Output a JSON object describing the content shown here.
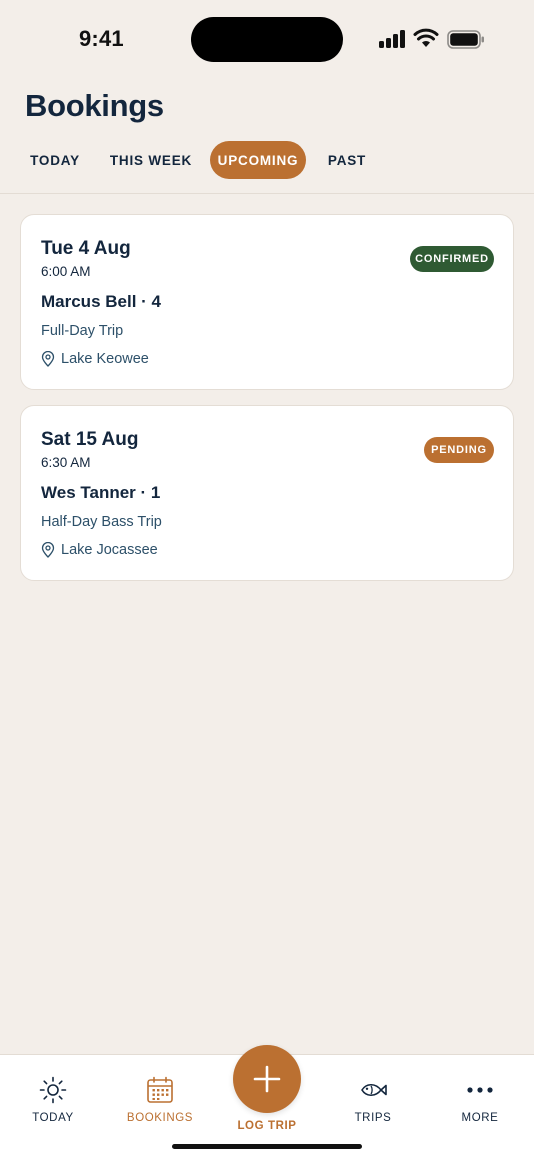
{
  "status_bar": {
    "time": "9:41"
  },
  "header": {
    "title": "Bookings"
  },
  "tabs": [
    {
      "label": "TODAY"
    },
    {
      "label": "THIS WEEK"
    },
    {
      "label": "UPCOMING"
    },
    {
      "label": "PAST"
    }
  ],
  "selected_tab": "UPCOMING",
  "bookings": [
    {
      "date": "Tue 4 Aug",
      "time": "6:00 AM",
      "client": "Marcus Bell · 4",
      "trip": "Full-Day Trip",
      "location": "Lake Keowee",
      "status": "CONFIRMED"
    },
    {
      "date": "Sat 15 Aug",
      "time": "6:30 AM",
      "client": "Wes Tanner · 1",
      "trip": "Half-Day Bass Trip",
      "location": "Lake Jocassee",
      "status": "PENDING"
    }
  ],
  "bottom_nav": {
    "items": [
      {
        "label": "TODAY",
        "icon": "sun-icon"
      },
      {
        "label": "BOOKINGS",
        "icon": "calendar-icon"
      },
      {
        "label": "TRIPS",
        "icon": "fish-icon"
      },
      {
        "label": "MORE",
        "icon": "more-dots-icon"
      }
    ],
    "active": "BOOKINGS",
    "fab_label": "LOG TRIP",
    "fab_icon": "plus-icon"
  },
  "colors": {
    "accent": "#bb7031",
    "navy": "#13263d",
    "confirmed": "#2f5a33",
    "background": "#f3eee9"
  }
}
